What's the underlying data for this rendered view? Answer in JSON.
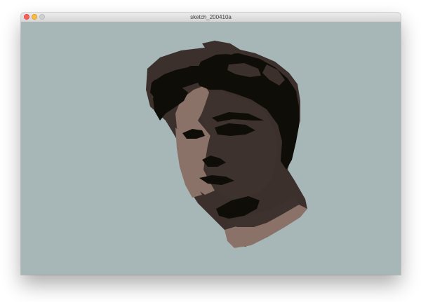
{
  "window": {
    "title": "sketch_200410a"
  },
  "colors": {
    "canvas_background": "#a7b6b7",
    "hair": "#0f0d08",
    "hair_brown": "#3b302b",
    "skin_light": "#8a7268",
    "skin_shadow": "#3d322d",
    "close_button": "#fc605c",
    "minimize_button": "#fdbc40",
    "zoom_button": "#d0d0d0"
  },
  "canvas": {
    "content": "portrait-illustration"
  }
}
